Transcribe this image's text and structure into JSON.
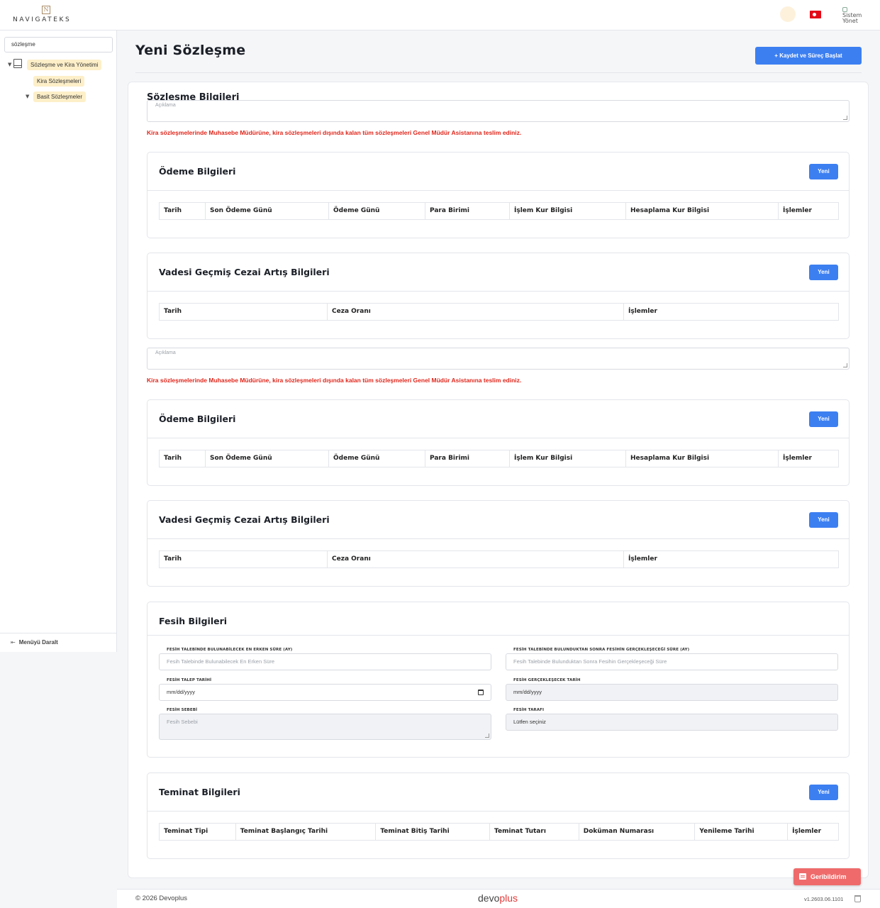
{
  "header": {
    "logo_mark": "N",
    "logo_text": "NAVIGATEKS",
    "user_image_alt": "Sistem Yönet"
  },
  "sidebar": {
    "search_value": "sözleşme",
    "tree": {
      "root_label": "Sözleşme ve Kira Yönetimi",
      "child_1": "Kira Sözleşmeleri",
      "child_2": "Basit Sözleşmeler"
    },
    "collapse_label": "Menüyü Daralt"
  },
  "main": {
    "page_title": "Yeni Sözleşme",
    "save_button": "+ Kaydet ve Süreç Başlat",
    "card_title": "Sözlesme Bilgileri",
    "description_placeholder": "Açıklama",
    "warning_text": "Kira sözleşmelerinde Muhasebe Müdürüne, kira sözleşmeleri dışında kalan tüm sözleşmeleri Genel Müdür Asistanına teslim ediniz.",
    "new_label": "Yeni",
    "payment_title": "Ödeme Bilgileri",
    "payment_columns": [
      "Tarih",
      "Son Ödeme Günü",
      "Ödeme Günü",
      "Para Birimi",
      "İşlem Kur Bilgisi",
      "Hesaplama Kur Bilgisi",
      "İşlemler"
    ],
    "penalty_title": "Vadesi Geçmiş Cezai Artış Bilgileri",
    "penalty_columns": [
      "Tarih",
      "Ceza Oranı",
      "İşlemler"
    ],
    "termination": {
      "title": "Fesih Bilgileri",
      "earliest_label": "FESİH TALEBİNDE BULUNABİLECEK EN ERKEN SÜRE (AY)",
      "earliest_placeholder": "Fesih Talebinde Bulunabilecek En Erken Süre",
      "after_label": "FESİH TALEBİNDE BULUNDUKTAN SONRA FESİHİN GERÇEKLEŞECEĞİ SÜRE (AY)",
      "after_placeholder": "Fesih Talebinde Bulunduktan Sonra Fesihin Gerçekleşeceği Süre",
      "request_date_label": "FESİH TALEP TARİHİ",
      "request_date_value": "mm/dd/yyyy",
      "realize_date_label": "FESİH GERÇEKLEŞECEK TARİH",
      "realize_date_value": "mm/dd/yyyy",
      "reason_label": "FESİH SEBEBİ",
      "reason_placeholder": "Fesih Sebebi",
      "party_label": "FESİH TARAFI",
      "party_value": "Lütfen seçiniz"
    },
    "guarantee_title": "Teminat Bilgileri",
    "guarantee_columns": [
      "Teminat Tipi",
      "Teminat Başlangıç Tarihi",
      "Teminat Bitiş Tarihi",
      "Teminat Tutarı",
      "Doküman Numarası",
      "Yenileme Tarihi",
      "İşlemler"
    ]
  },
  "footer": {
    "copyright": "© 2026 Devoplus",
    "brand_a": "devo",
    "brand_b": "plus",
    "version": "v1.2603.06.1101",
    "feedback": "Geribildirim"
  },
  "colors": {
    "accent": "#3c7ff1",
    "warning": "#e0261b",
    "feedback": "#ef6b6b",
    "highlight": "#fdefc8"
  }
}
